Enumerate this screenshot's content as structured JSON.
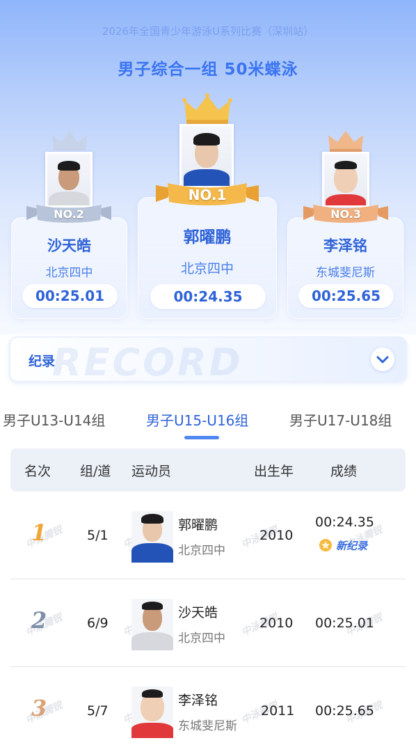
{
  "header": {
    "competition": "2026年全国青少年游泳U系列比赛（深圳站）",
    "event": "男子综合一组 50米蝶泳"
  },
  "podium": [
    {
      "rank_label": "NO.1",
      "name": "郭曜鹏",
      "club": "北京四中",
      "time": "00:24.35"
    },
    {
      "rank_label": "NO.2",
      "name": "沙天皓",
      "club": "北京四中",
      "time": "00:25.01"
    },
    {
      "rank_label": "NO.3",
      "name": "李泽铭",
      "club": "东城斐尼斯",
      "time": "00:25.65"
    }
  ],
  "record": {
    "label": "纪录",
    "watermark": "RECORD",
    "toggle_icon": "chevron-down-icon"
  },
  "tabs": [
    {
      "label": "男子U13-U14组",
      "active": false
    },
    {
      "label": "男子U15-U16组",
      "active": true
    },
    {
      "label": "男子U17-U18组",
      "active": false
    }
  ],
  "table": {
    "headers": {
      "rank": "名次",
      "lane": "组/道",
      "athlete": "运动员",
      "birth": "出生年",
      "result": "成绩"
    },
    "rows": [
      {
        "rank": "1",
        "lane": "5/1",
        "name": "郭曜鹏",
        "club": "北京四中",
        "birth": "2010",
        "result": "00:24.35",
        "badge": "新纪录"
      },
      {
        "rank": "2",
        "lane": "6/9",
        "name": "沙天皓",
        "club": "北京四中",
        "birth": "2010",
        "result": "00:25.01",
        "badge": ""
      },
      {
        "rank": "3",
        "lane": "5/7",
        "name": "李泽铭",
        "club": "东城斐尼斯",
        "birth": "2011",
        "result": "00:25.65",
        "badge": ""
      }
    ]
  },
  "watermark_text": "中泳腾锐",
  "colors": {
    "accent": "#2f63d8",
    "gold": "#f3b33d",
    "silver": "#9aa8bf",
    "bronze": "#e9a877",
    "rank1": "#f0a637",
    "rank2": "#7f8fa8",
    "rank3": "#d9a274"
  }
}
